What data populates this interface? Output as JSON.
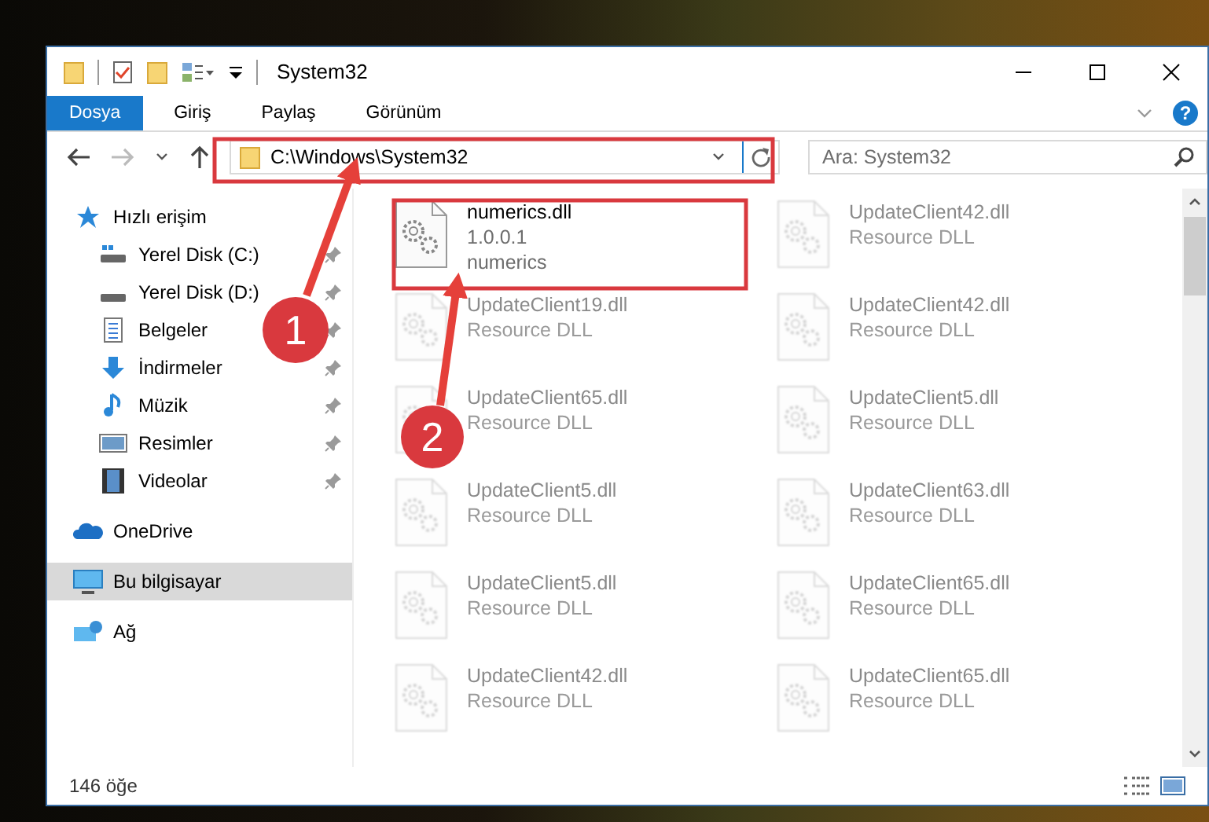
{
  "window": {
    "title": "System32"
  },
  "ribbon": {
    "tabs": [
      {
        "label": "Dosya",
        "kind": "file",
        "selected": false
      },
      {
        "label": "Giriş",
        "kind": "tab",
        "selected": false
      },
      {
        "label": "Paylaş",
        "kind": "tab",
        "selected": false
      },
      {
        "label": "Görünüm",
        "kind": "tab",
        "selected": false
      }
    ],
    "help": "?"
  },
  "address_bar": {
    "path": "C:\\Windows\\System32"
  },
  "search": {
    "placeholder": "Ara: System32"
  },
  "sidebar": {
    "items": [
      {
        "label": "Hızlı erişim",
        "selected": false,
        "children": [
          {
            "label": "Yerel Disk (C:)",
            "pinned": true,
            "selected": false
          },
          {
            "label": "Yerel Disk (D:)",
            "pinned": true,
            "selected": false
          },
          {
            "label": "Belgeler",
            "pinned": true,
            "selected": false
          },
          {
            "label": "İndirmeler",
            "pinned": true,
            "selected": false
          },
          {
            "label": "Müzik",
            "pinned": true,
            "selected": false
          },
          {
            "label": "Resimler",
            "pinned": true,
            "selected": false
          },
          {
            "label": "Videolar",
            "pinned": true,
            "selected": false
          }
        ]
      },
      {
        "label": "OneDrive",
        "selected": false
      },
      {
        "label": "Bu bilgisayar",
        "selected": true
      },
      {
        "label": "Ağ",
        "selected": false
      }
    ]
  },
  "files": [
    {
      "name": "numerics.dll",
      "details": [
        "1.0.0.1",
        "numerics"
      ],
      "blurred": false
    },
    {
      "name": "UpdateClient42.dll",
      "details": [
        "Resource DLL"
      ],
      "blurred": true
    },
    {
      "name": "UpdateClient19.dll",
      "details": [
        "Resource DLL"
      ],
      "blurred": true
    },
    {
      "name": "UpdateClient42.dll",
      "details": [
        "Resource DLL"
      ],
      "blurred": true
    },
    {
      "name": "UpdateClient65.dll",
      "details": [
        "Resource DLL"
      ],
      "blurred": true
    },
    {
      "name": "UpdateClient5.dll",
      "details": [
        "Resource DLL"
      ],
      "blurred": true
    },
    {
      "name": "UpdateClient5.dll",
      "details": [
        "Resource DLL"
      ],
      "blurred": true
    },
    {
      "name": "UpdateClient63.dll",
      "details": [
        "Resource DLL"
      ],
      "blurred": true
    },
    {
      "name": "UpdateClient5.dll",
      "details": [
        "Resource DLL"
      ],
      "blurred": true
    },
    {
      "name": "UpdateClient65.dll",
      "details": [
        "Resource DLL"
      ],
      "blurred": true
    },
    {
      "name": "UpdateClient42.dll",
      "details": [
        "Resource DLL"
      ],
      "blurred": true
    },
    {
      "name": "UpdateClient65.dll",
      "details": [
        "Resource DLL"
      ],
      "blurred": true
    }
  ],
  "status_bar": {
    "count": "146 öğe"
  },
  "callouts": [
    {
      "label": "1"
    },
    {
      "label": "2"
    }
  ]
}
